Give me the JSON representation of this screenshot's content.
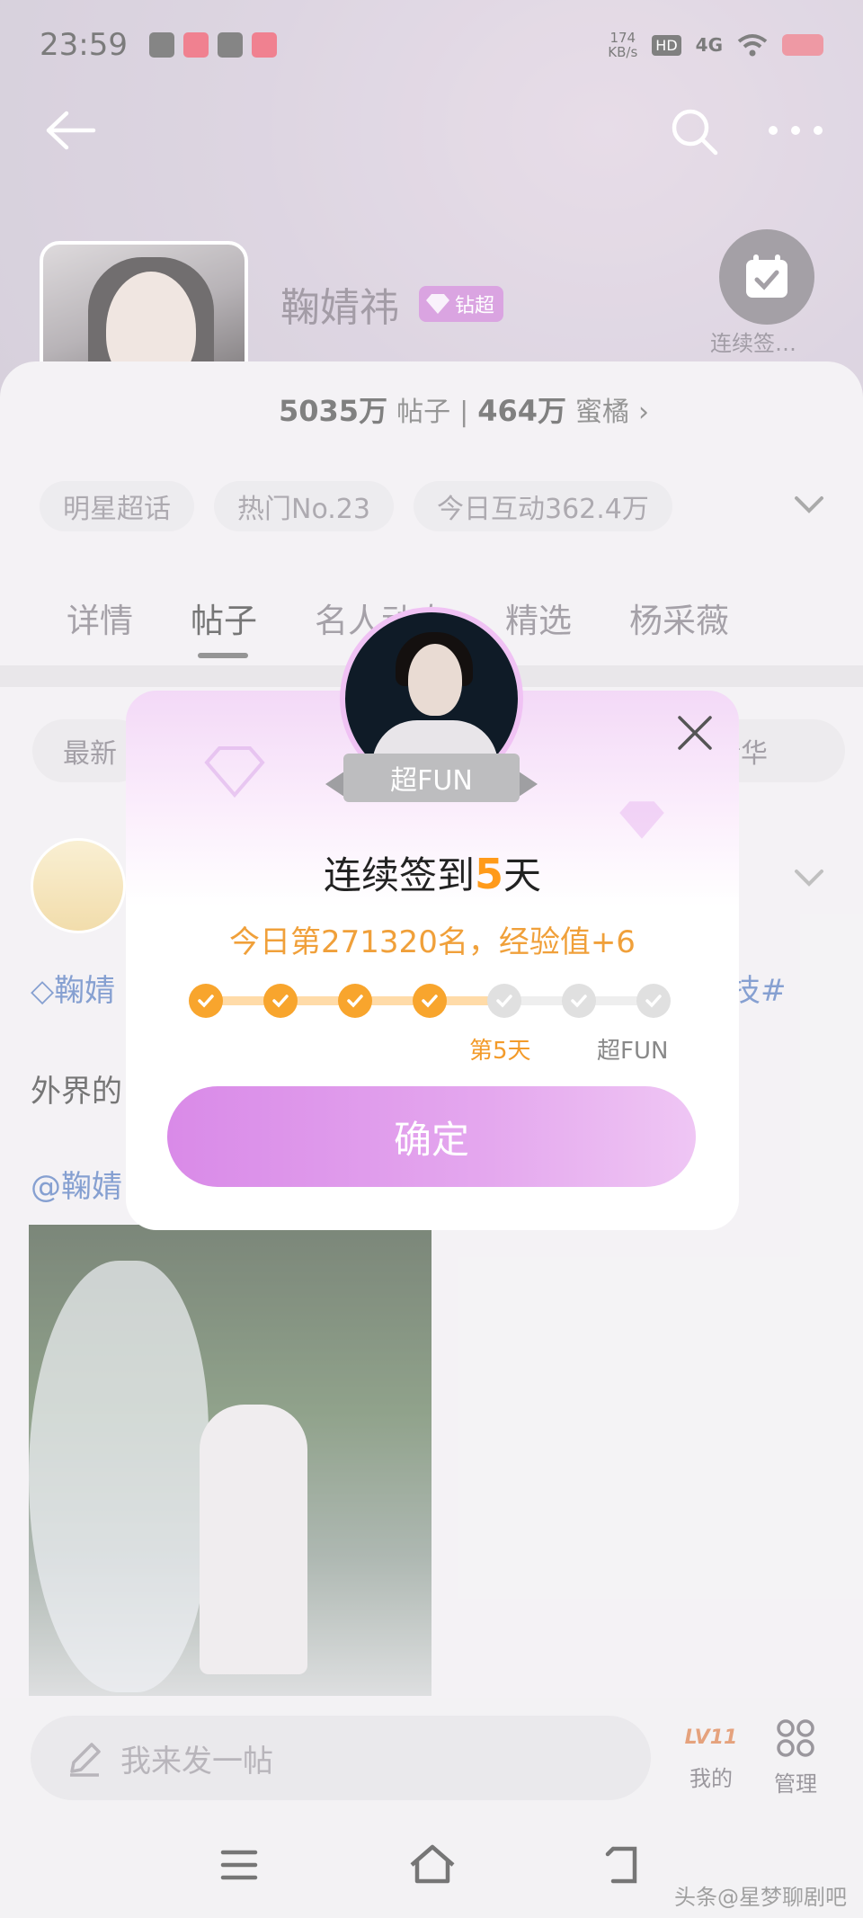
{
  "status_bar": {
    "time": "23:59",
    "speed": "174\nKB/s",
    "hd": "HD",
    "network": "4G"
  },
  "profile": {
    "name": "鞠婧祎",
    "badge": "钻超",
    "checkin_label": "连续签…",
    "posts_count": "5035万",
    "posts_label": "帖子",
    "fans_count": "464万",
    "fans_label": "蜜橘"
  },
  "tags": [
    "明星超话",
    "热门No.23",
    "今日互动362.4万"
  ],
  "tabs": [
    "详情",
    "帖子",
    "名人动态",
    "精选",
    "杨采薇"
  ],
  "filters": {
    "latest": "最新",
    "essence": "精华"
  },
  "post": {
    "line1_start": "鞠婧",
    "line1_end": "技#",
    "line2": "外界的",
    "line3": "@鞠婧"
  },
  "bottom": {
    "compose_placeholder": "我来发一帖",
    "level": "LV11",
    "mine_label": "我的",
    "manage_label": "管理"
  },
  "watermark": "头条@星梦聊剧吧",
  "popup": {
    "ribbon": "超FUN",
    "title_prefix": "连续签到",
    "title_days": "5",
    "title_suffix": "天",
    "rank_text": "今日第271320名，经验值+6",
    "current_label": "第5天",
    "final_label": "超FUN",
    "confirm": "确定",
    "completed_days": 4,
    "total_steps": 7
  },
  "colors": {
    "accent_orange": "#f8a52d",
    "button_purple": "#d98ae8",
    "link_blue": "#3d67b5"
  }
}
